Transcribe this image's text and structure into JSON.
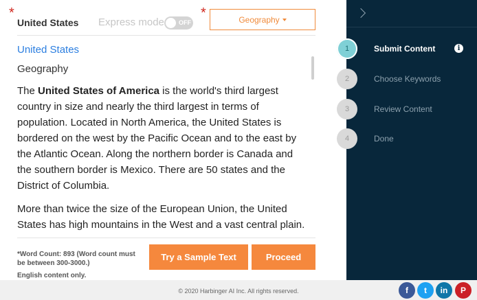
{
  "header": {
    "title_label": "United States",
    "express_mode_label": "Express mode",
    "express_toggle_state": "OFF",
    "category_button_label": "Geography",
    "required_marker": "*"
  },
  "document": {
    "title": "United States",
    "category": "Geography",
    "paragraph1": {
      "pre": "The ",
      "bold": "United States of America",
      "post": " is the world's third largest country in size and nearly the third largest in terms of population. Located in North America, the United States is bordered on the west by the Pacific Ocean and to the east by the Atlantic Ocean. Along the northern border is Canada and the southern border is Mexico. There are 50 states and the District of Columbia."
    },
    "paragraph2": "More than twice the size of the European Union, the United States has high mountains in the West and a vast central plain."
  },
  "bottom_bar": {
    "word_count_note": "*Word Count: 893 (Word count must be between 300-3000.)",
    "language_note": "English content only.",
    "sample_button_label": "Try a Sample Text",
    "proceed_button_label": "Proceed"
  },
  "sidebar": {
    "steps": [
      {
        "number": "1",
        "label": "Submit Content",
        "active": true
      },
      {
        "number": "2",
        "label": "Choose Keywords",
        "active": false
      },
      {
        "number": "3",
        "label": "Review Content",
        "active": false
      },
      {
        "number": "4",
        "label": "Done",
        "active": false
      }
    ],
    "info_glyph": "i"
  },
  "footer": {
    "copyright": "© 2020 Harbinger AI Inc. All rights reserved.",
    "social": [
      {
        "icon": "facebook-icon",
        "glyph": "f",
        "color": "#3b5998"
      },
      {
        "icon": "twitter-icon",
        "glyph": "t",
        "color": "#1da1f2"
      },
      {
        "icon": "linkedin-icon",
        "glyph": "in",
        "color": "#0e76a8"
      },
      {
        "icon": "pinterest-icon",
        "glyph": "P",
        "color": "#cb2027"
      }
    ]
  },
  "colors": {
    "accent_orange": "#f5883d",
    "sidebar_bg": "#08273b",
    "link_blue": "#2b7ee0",
    "active_step": "#7fd0d6",
    "required_red": "#d0281f"
  }
}
